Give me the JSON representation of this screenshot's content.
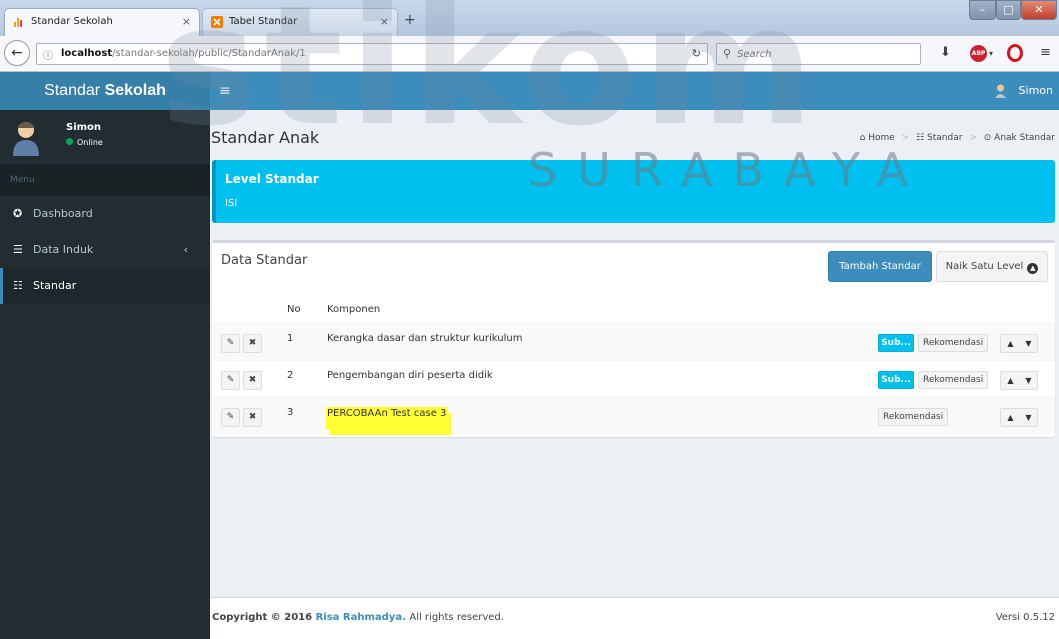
{
  "browser": {
    "tabs": [
      {
        "title": "Standar Sekolah",
        "close": "×"
      },
      {
        "title": "Tabel Standar",
        "close": "×"
      }
    ],
    "newtab": "+",
    "url_host": "localhost",
    "url_path": "/standar-sekolah/public/StandarAnak/1",
    "search_placeholder": "Search"
  },
  "header": {
    "logo_part1": "Standar",
    "logo_part2": "Sekolah",
    "toggle": "≡",
    "user": "Simon"
  },
  "sidebar": {
    "user_name": "Simon",
    "user_status": "Online",
    "menu_header": "Menu",
    "items": [
      {
        "label": "Dashboard",
        "icon": "dashboard-icon"
      },
      {
        "label": "Data Induk",
        "icon": "database-icon"
      },
      {
        "label": "Standar",
        "icon": "sliders-icon"
      }
    ]
  },
  "content": {
    "title": "Standar Anak",
    "breadcrumb": [
      "Home",
      "Standar",
      "Anak Standar"
    ]
  },
  "callout": {
    "title": "Level Standar",
    "text": "ISI"
  },
  "box": {
    "title": "Data Standar",
    "btn_add": "Tambah Standar",
    "btn_up": "Naik Satu Level",
    "headers": {
      "no": "No",
      "komponen": "Komponen"
    },
    "rows": [
      {
        "no": "1",
        "komponen": "Kerangka dasar dan struktur kurikulum",
        "has_sub": true,
        "sub": "Sub...",
        "rek": "Rekomendasi"
      },
      {
        "no": "2",
        "komponen": "Pengembangan diri peserta didik",
        "has_sub": true,
        "sub": "Sub...",
        "rek": "Rekomendasi"
      },
      {
        "no": "3",
        "komponen": "PERCOBAAn Test case 3",
        "has_sub": false,
        "sub": "",
        "rek": "Rekomendasi"
      }
    ]
  },
  "footer": {
    "copy_prefix": "Copyright © 2016",
    "author": "Risa Rahmadya.",
    "copy_suffix": "All rights reserved.",
    "version": "Versi 0.5.12"
  },
  "watermark": {
    "main": "stikom",
    "sub": "SURABAYA"
  },
  "colors": {
    "primary": "#3c8dbc",
    "sidebar": "#222d32",
    "info": "#00c0ef",
    "highlight": "#ffff33"
  }
}
